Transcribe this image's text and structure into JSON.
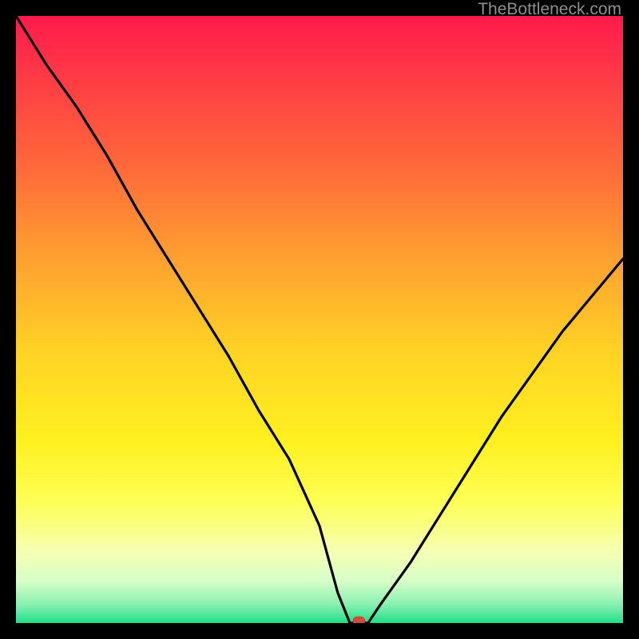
{
  "watermark": "TheBottleneck.com",
  "chart_data": {
    "type": "line",
    "title": "",
    "xlabel": "",
    "ylabel": "",
    "xlim": [
      0,
      100
    ],
    "ylim": [
      0,
      100
    ],
    "series": [
      {
        "name": "bottleneck-curve",
        "x": [
          0,
          5,
          10,
          15,
          20,
          25,
          30,
          35,
          40,
          45,
          50,
          53,
          55,
          58,
          60,
          65,
          70,
          75,
          80,
          85,
          90,
          95,
          100
        ],
        "y": [
          100,
          92,
          85,
          77,
          68,
          60,
          52,
          44,
          35,
          27,
          16,
          5,
          0,
          0,
          3,
          10,
          18,
          26,
          34,
          41,
          48,
          54,
          60
        ]
      }
    ],
    "marker": {
      "x": 56.5,
      "y": 0,
      "color": "#d64a3a"
    },
    "gradient_stops": [
      {
        "offset": 0.0,
        "color": "#ff1a4b"
      },
      {
        "offset": 0.1,
        "color": "#ff3a45"
      },
      {
        "offset": 0.25,
        "color": "#ff6a3a"
      },
      {
        "offset": 0.4,
        "color": "#ffa030"
      },
      {
        "offset": 0.55,
        "color": "#ffd225"
      },
      {
        "offset": 0.7,
        "color": "#fff020"
      },
      {
        "offset": 0.8,
        "color": "#fdff55"
      },
      {
        "offset": 0.88,
        "color": "#f6ffb0"
      },
      {
        "offset": 0.93,
        "color": "#d8ffc8"
      },
      {
        "offset": 0.97,
        "color": "#88f0b0"
      },
      {
        "offset": 1.0,
        "color": "#20e088"
      }
    ]
  }
}
